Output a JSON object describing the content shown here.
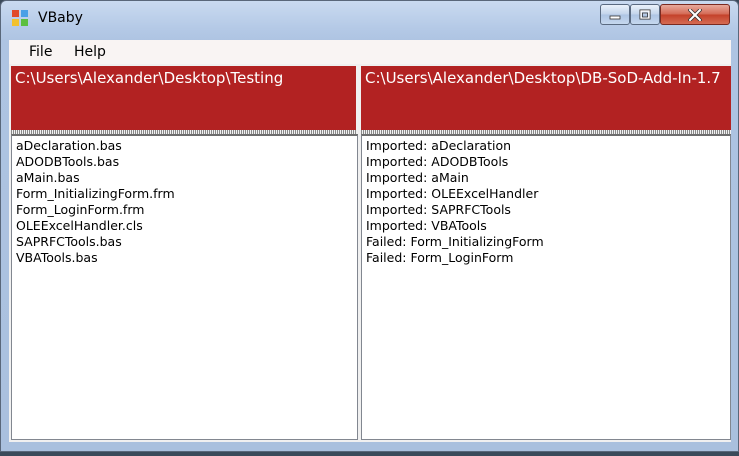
{
  "window": {
    "title": "VBaby",
    "controls": [
      "minimize",
      "maximize",
      "close"
    ]
  },
  "menu": [
    "File",
    "Help"
  ],
  "left_panel": {
    "path": "C:\\Users\\Alexander\\Desktop\\Testing",
    "files": [
      "aDeclaration.bas",
      "ADODBTools.bas",
      "aMain.bas",
      "Form_InitializingForm.frm",
      "Form_LoginForm.frm",
      "OLEExcelHandler.cls",
      "SAPRFCTools.bas",
      "VBATools.bas"
    ]
  },
  "right_panel": {
    "path": "C:\\Users\\Alexander\\Desktop\\DB-SoD-Add-In-1.7",
    "log": [
      "Imported: aDeclaration",
      "Imported: ADODBTools",
      "Imported: aMain",
      "Imported: OLEExcelHandler",
      "Imported: SAPRFCTools",
      "Imported: VBATools",
      "Failed: Form_InitializingForm",
      "Failed: Form_LoginForm"
    ]
  },
  "colors": {
    "header_bg": "#b22222",
    "header_text": "#ffffff",
    "close_button": "#c4412a"
  },
  "icons": [
    "app-icon",
    "minimize-icon",
    "maximize-icon",
    "close-icon"
  ]
}
